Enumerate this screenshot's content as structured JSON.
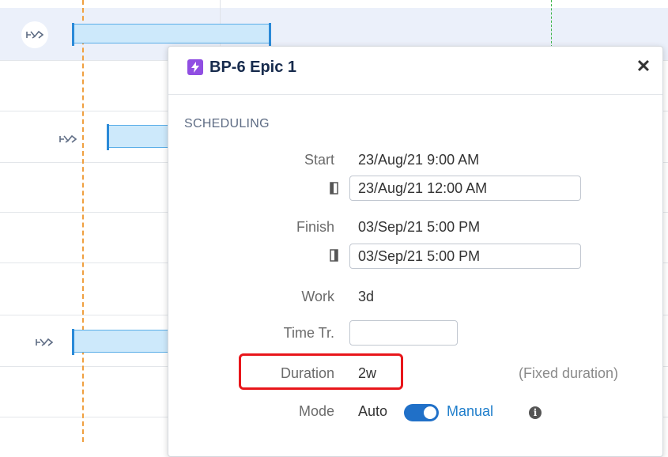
{
  "popup": {
    "title": "BP-6 Epic 1",
    "close_glyph": "✕",
    "section": "SCHEDULING",
    "icon": "lightning-icon",
    "accent": "#904ee2"
  },
  "scheduling": {
    "start_label": "Start",
    "start_value": "23/Aug/21 9:00 AM",
    "start_input": "23/Aug/21 12:00 AM",
    "finish_label": "Finish",
    "finish_value": "03/Sep/21 5:00 PM",
    "finish_input": "03/Sep/21 5:00 PM",
    "work_label": "Work",
    "work_value": "3d",
    "time_tracked_label": "Time Tr.",
    "time_tracked_value": "",
    "duration_label": "Duration",
    "duration_value": "2w",
    "duration_note": "(Fixed duration)",
    "mode_label": "Mode",
    "mode_auto": "Auto",
    "mode_manual": "Manual",
    "mode_selected": "Manual"
  },
  "colors": {
    "bar_fill": "#cde9fb",
    "bar_edge": "#2a8ad8",
    "today_line": "#f0a040",
    "highlight": "#e8161b",
    "toggle": "#2070c8"
  }
}
